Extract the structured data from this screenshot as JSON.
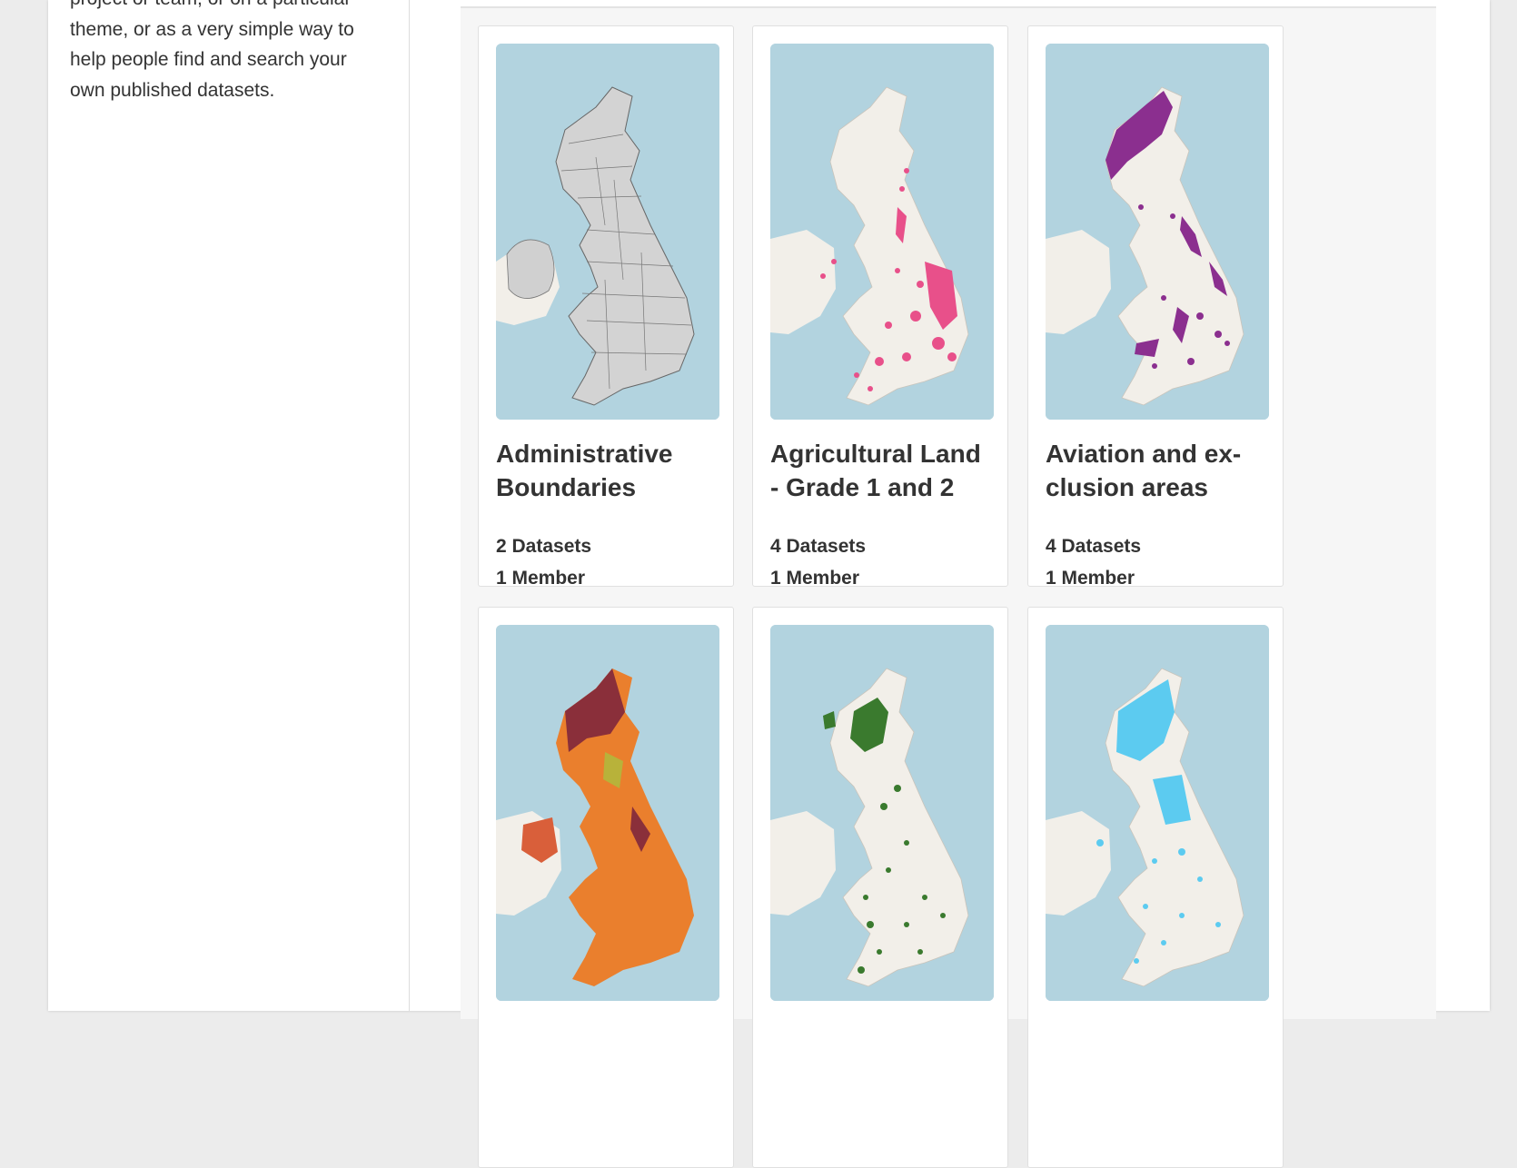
{
  "sidebar": {
    "description_lines": [
      "project or team, or on a particular",
      "theme, or as a very simple way to",
      "help people find and search your",
      "own published datasets."
    ]
  },
  "groups": [
    {
      "title_lines": [
        "Administrative",
        "Boundaries"
      ],
      "datasets": "2 Datasets",
      "members": "1 Member",
      "map_icon": "uk-boundaries-map",
      "accent": "#cfcfcf"
    },
    {
      "title_lines": [
        "Agricultural Land",
        "- Grade 1 and 2"
      ],
      "datasets": "4 Datasets",
      "members": "1 Member",
      "map_icon": "uk-agricultural-land-map",
      "accent": "#e8508a"
    },
    {
      "title_lines": [
        "Aviation and ex-",
        "clusion areas"
      ],
      "datasets": "4 Datasets",
      "members": "1 Member",
      "map_icon": "uk-aviation-exclusion-map",
      "accent": "#8b2f8f"
    },
    {
      "title_lines": [],
      "datasets": "",
      "members": "",
      "map_icon": "uk-land-cover-map",
      "accent": "#ea7f2d"
    },
    {
      "title_lines": [],
      "datasets": "",
      "members": "",
      "map_icon": "uk-woodland-map",
      "accent": "#3a7a2e"
    },
    {
      "title_lines": [],
      "datasets": "",
      "members": "",
      "map_icon": "uk-water-bodies-map",
      "accent": "#5ccbf0"
    }
  ],
  "colors": {
    "sea": "#b2d3df",
    "land": "#f2efe9",
    "page_background": "#ececec"
  }
}
